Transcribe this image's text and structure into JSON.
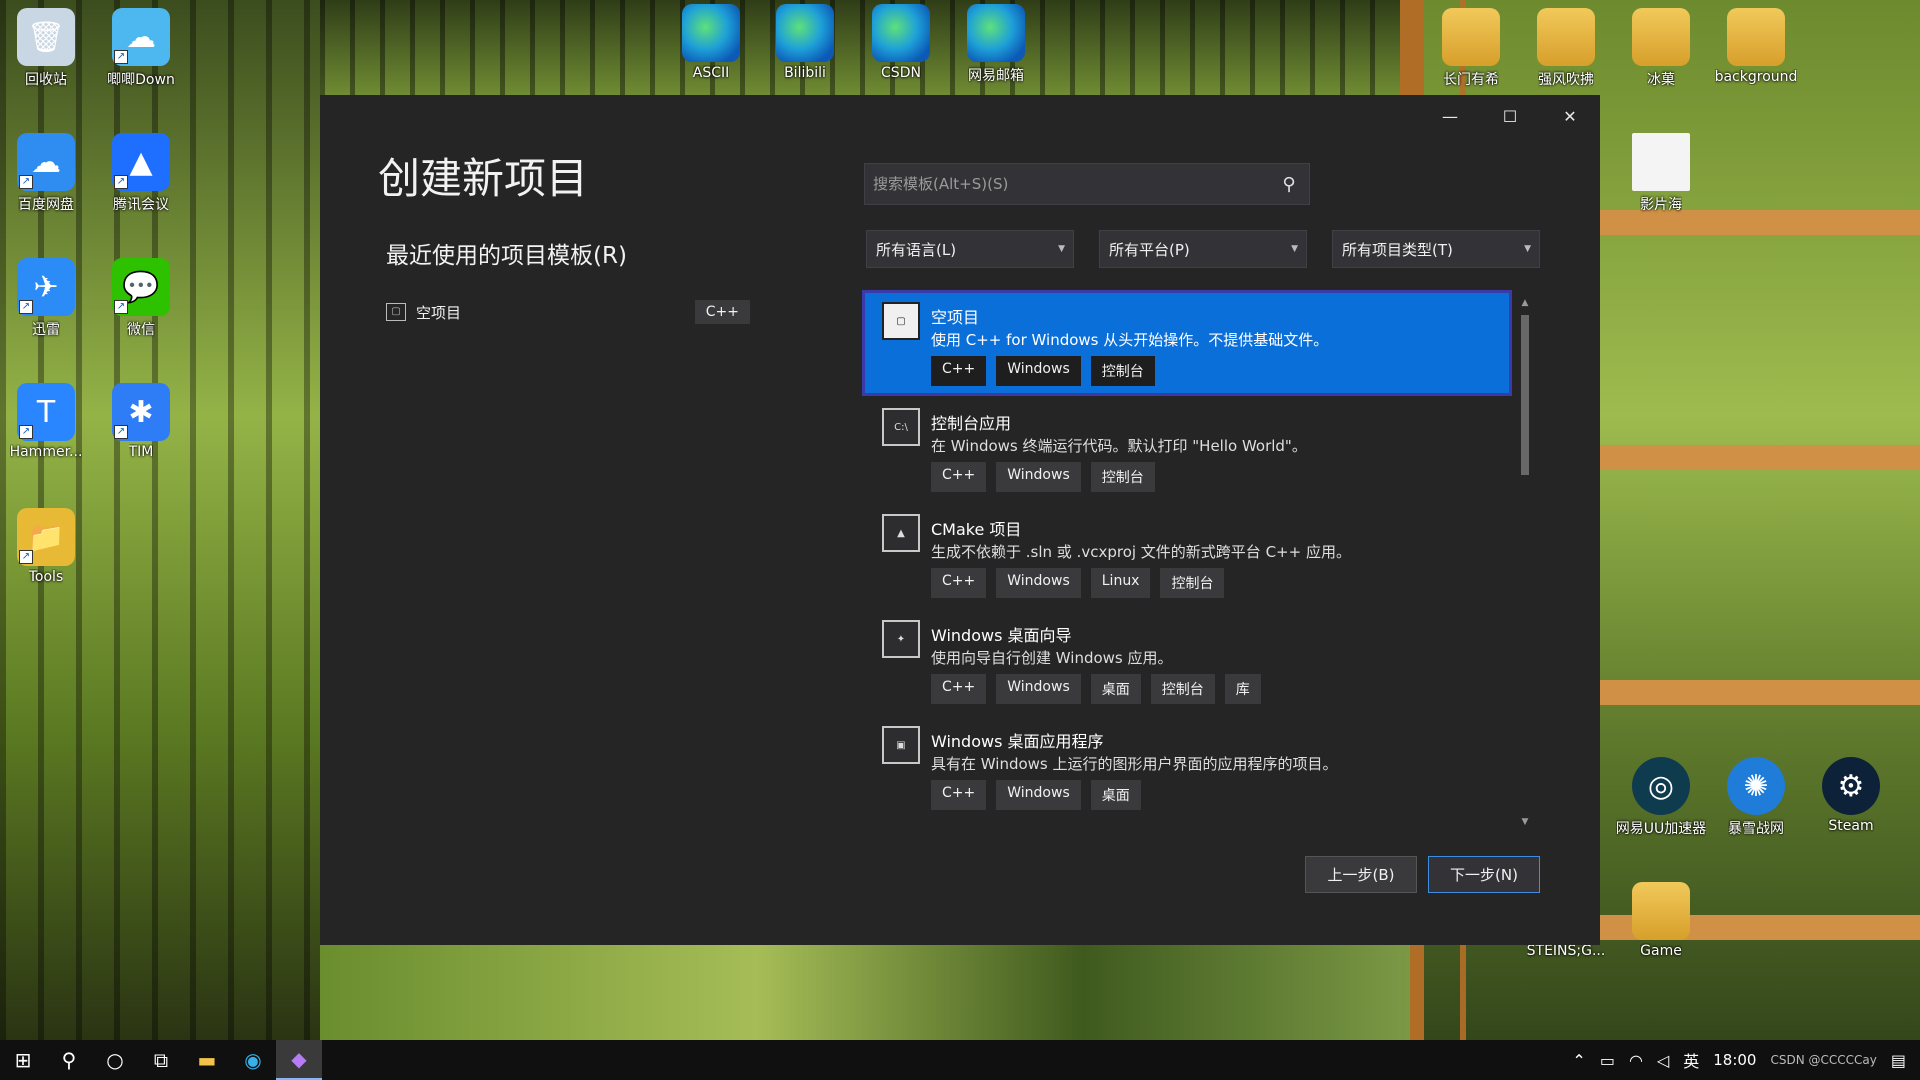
{
  "desktop": {
    "left_icons": [
      {
        "label": "回收站",
        "icon": "recycle-bin-icon",
        "glyph": "🗑",
        "color": "#c9d6e3"
      },
      {
        "label": "唧唧Down",
        "icon": "jijidown-icon",
        "glyph": "☁",
        "color": "#4db8ef"
      },
      {
        "label": "百度网盘",
        "icon": "baidu-netdisk-icon",
        "glyph": "☁",
        "color": "#2f8cf0"
      },
      {
        "label": "腾讯会议",
        "icon": "tencent-meeting-icon",
        "glyph": "▲",
        "color": "#1e6fff"
      },
      {
        "label": "迅雷",
        "icon": "xunlei-icon",
        "glyph": "✈",
        "color": "#2b8cf7"
      },
      {
        "label": "微信",
        "icon": "wechat-icon",
        "glyph": "💬",
        "color": "#2dc100"
      },
      {
        "label": "Hammer...",
        "icon": "hammer-icon",
        "glyph": "T",
        "color": "#2a86ff"
      },
      {
        "label": "TIM",
        "icon": "tim-icon",
        "glyph": "✱",
        "color": "#2f7df6"
      },
      {
        "label": "Tools",
        "icon": "tools-folder-icon",
        "glyph": "📁",
        "color": "#e8b935"
      }
    ],
    "top_icons": [
      {
        "label": "ASCII",
        "icon": "edge-icon"
      },
      {
        "label": "Bilibili",
        "icon": "edge-icon"
      },
      {
        "label": "CSDN",
        "icon": "edge-icon"
      },
      {
        "label": "网易邮箱",
        "icon": "edge-icon"
      }
    ],
    "right_icons": [
      {
        "label": "长门有希",
        "icon": "folder-icon"
      },
      {
        "label": "强风吹拂",
        "icon": "folder-icon"
      },
      {
        "label": "冰菓",
        "icon": "folder-icon"
      },
      {
        "label": "background",
        "icon": "folder-icon"
      },
      {
        "label": "影片海",
        "icon": "file-icon"
      },
      {
        "label": "网易UU加速器",
        "icon": "uu-booster-icon"
      },
      {
        "label": "暴雪战网",
        "icon": "battlenet-icon"
      },
      {
        "label": "Steam",
        "icon": "steam-icon"
      },
      {
        "label": "STEINS;G...",
        "icon": "folder-icon"
      },
      {
        "label": "Game",
        "icon": "folder-icon"
      }
    ]
  },
  "dialog": {
    "title": "创建新项目",
    "recent_heading": "最近使用的项目模板(R)",
    "recent_items": [
      {
        "name": "空项目",
        "tag": "C++"
      }
    ],
    "search": {
      "placeholder": "搜索模板(Alt+S)(S)"
    },
    "filters": [
      {
        "label": "所有语言(L)"
      },
      {
        "label": "所有平台(P)"
      },
      {
        "label": "所有项目类型(T)"
      }
    ],
    "templates": [
      {
        "name": "空项目",
        "desc": "使用 C++ for Windows 从头开始操作。不提供基础文件。",
        "tags": [
          "C++",
          "Windows",
          "控制台"
        ],
        "selected": true
      },
      {
        "name": "控制台应用",
        "desc": "在 Windows 终端运行代码。默认打印 \"Hello World\"。",
        "tags": [
          "C++",
          "Windows",
          "控制台"
        ],
        "selected": false
      },
      {
        "name": "CMake 项目",
        "desc": "生成不依赖于 .sln 或 .vcxproj 文件的新式跨平台 C++ 应用。",
        "tags": [
          "C++",
          "Windows",
          "Linux",
          "控制台"
        ],
        "selected": false
      },
      {
        "name": "Windows 桌面向导",
        "desc": "使用向导自行创建 Windows 应用。",
        "tags": [
          "C++",
          "Windows",
          "桌面",
          "控制台",
          "库"
        ],
        "selected": false
      },
      {
        "name": "Windows 桌面应用程序",
        "desc": "具有在 Windows 上运行的图形用户界面的应用程序的项目。",
        "tags": [
          "C++",
          "Windows",
          "桌面"
        ],
        "selected": false
      }
    ],
    "back_button": "上一步(B)",
    "next_button": "下一步(N)",
    "window_controls": {
      "minimize": "—",
      "maximize": "☐",
      "close": "✕"
    }
  },
  "taskbar": {
    "ime": "英",
    "clock": "18:00",
    "watermark": "CSDN @CCCCCay"
  }
}
